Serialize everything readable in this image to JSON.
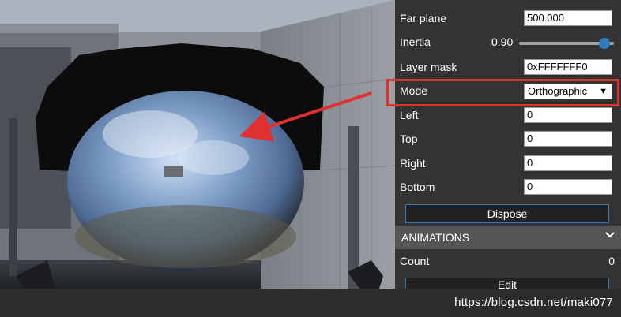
{
  "inspector": {
    "far_plane": {
      "label": "Far plane",
      "value": "500.000"
    },
    "inertia": {
      "label": "Inertia",
      "value": "0.90",
      "level": 0.9
    },
    "layer_mask": {
      "label": "Layer mask",
      "value": "0xFFFFFFF0"
    },
    "mode": {
      "label": "Mode",
      "value": "Orthographic"
    },
    "left": {
      "label": "Left",
      "value": "0"
    },
    "top": {
      "label": "Top",
      "value": "0"
    },
    "right": {
      "label": "Right",
      "value": "0"
    },
    "bottom": {
      "label": "Bottom",
      "value": "0"
    },
    "dispose_label": "Dispose",
    "animations": {
      "title": "ANIMATIONS",
      "count_label": "Count",
      "count_value": "0",
      "edit_label": "Edit"
    }
  },
  "watermark": "https://blog.csdn.net/maki077",
  "colors": {
    "accent": "#2e7bbf",
    "highlight": "#e03030",
    "panel_bg": "#333333",
    "section_bg": "#555555"
  },
  "icons": {
    "section_toggle": "chevron-down-icon",
    "select_arrow": "triangle-down-icon"
  }
}
